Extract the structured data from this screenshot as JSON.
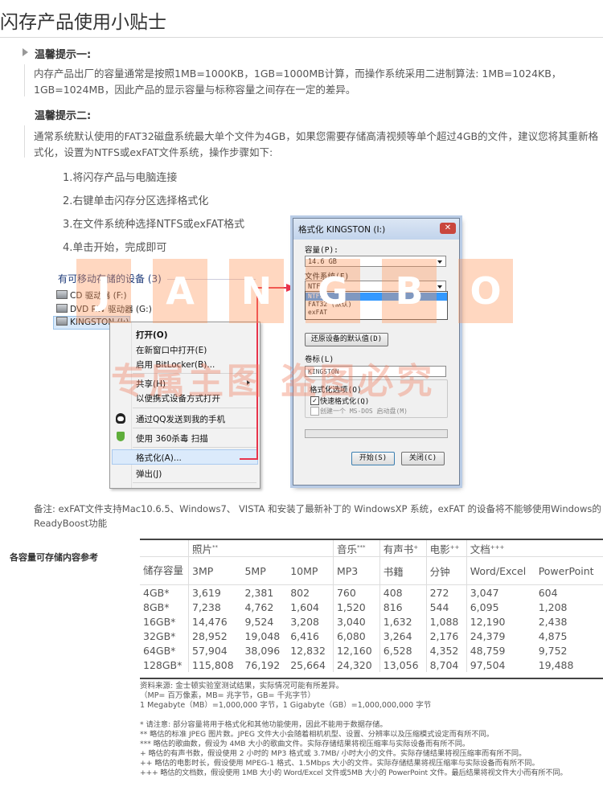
{
  "page": {
    "title": "闪存产品使用小贴士"
  },
  "tip1": {
    "heading": "温馨提示一:",
    "text": "内存产品出厂的容量通常是按照1MB=1000KB，1GB=1000MB计算，而操作系统采用二进制算法: 1MB=1024KB，1GB=1024MB，因此产品的显示容量与标称容量之间存在一定的差异。"
  },
  "tip2": {
    "heading": "温馨提示二:",
    "text": "通常系统默认使用的FAT32磁盘系统最大单个文件为4GB，如果您需要存储高清视频等单个超过4GB的文件，建议您将其重新格式化，设置为NTFS或exFAT文件系统，操作步骤如下:",
    "steps": [
      "1.将闪存产品与电脑连接",
      "2.右键单击闪存分区选择格式化",
      "3.在文件系统种选择NTFS或exFAT格式",
      "4.单击开始，完成即可"
    ]
  },
  "explorer": {
    "group_label": "有可移动存储的设备 (3)",
    "drives": [
      "CD 驱动器 (F:)",
      "DVD RW 驱动器 (G:)",
      "KINGSTON (I:)"
    ]
  },
  "context_menu": {
    "items": [
      "打开(O)",
      "在新窗口中打开(E)",
      "启用 BitLocker(B)...",
      "共享(H)",
      "以便携式设备方式打开",
      "通过QQ发送到我的手机",
      "使用 360杀毒 扫描",
      "格式化(A)...",
      "弹出(J)"
    ]
  },
  "format_dialog": {
    "title": "格式化 KINGSTON (I:)",
    "capacity_label": "容量(P):",
    "capacity_value": "14.6 GB",
    "fs_label": "文件系统(F)",
    "fs_value": "NTFS",
    "fs_options": [
      "NTFS",
      "FAT32 (默认)",
      "exFAT"
    ],
    "restore_button": "还原设备的默认值(D)",
    "volume_label": "卷标(L)",
    "volume_value": "KINGSTON",
    "options_label": "格式化选项(O)",
    "quick_format": "快速格式化(Q)",
    "msdos_disk": "创建一个 MS-DOS 启动盘(M)",
    "start_button": "开始(S)",
    "close_button": "关闭(C)"
  },
  "watermark": {
    "letters": [
      "J",
      "A",
      "N",
      "G",
      "B",
      "O"
    ],
    "text": "专属主图  盗图必究"
  },
  "note": "备注: exFAT文件支持Mac10.6.5、Windows7、 VISTA 和安装了最新补丁的 WindowsXP 系统，exFAT 的设备将不能够使用Windows的ReadyBoost功能",
  "capacity_table": {
    "side_label": "各容量可存储内容参考",
    "groups": [
      {
        "label": "照片",
        "mark": "**"
      },
      {
        "label": "音乐",
        "mark": "***"
      },
      {
        "label": "有声书",
        "mark": "+"
      },
      {
        "label": "电影",
        "mark": "++"
      },
      {
        "label": "文档",
        "mark": "+++"
      }
    ],
    "row_header": "储存容量",
    "subheaders": [
      "3MP",
      "5MP",
      "10MP",
      "MP3",
      "书籍",
      "分钟",
      "Word/Excel",
      "PowerPoint"
    ],
    "rows": [
      [
        "4GB*",
        "3,619",
        "2,381",
        "802",
        "760",
        "408",
        "272",
        "3,047",
        "604"
      ],
      [
        "8GB*",
        "7,238",
        "4,762",
        "1,604",
        "1,520",
        "816",
        "544",
        "6,095",
        "1,208"
      ],
      [
        "16GB*",
        "14,476",
        "9,524",
        "3,208",
        "3,040",
        "1,632",
        "1,088",
        "12,190",
        "2,438"
      ],
      [
        "32GB*",
        "28,952",
        "19,048",
        "6,416",
        "6,080",
        "3,264",
        "2,176",
        "24,379",
        "4,875"
      ],
      [
        "64GB*",
        "57,904",
        "38,096",
        "12,832",
        "12,160",
        "6,528",
        "4,352",
        "48,759",
        "9,752"
      ],
      [
        "128GB*",
        "115,808",
        "76,192",
        "25,664",
        "24,320",
        "13,056",
        "8,704",
        "97,504",
        "19,488"
      ]
    ]
  },
  "source": [
    "资料来源: 金士顿实验室测试结果，实际情况可能有所差异。",
    "（MP= 百万像素，MB= 兆字节，GB= 千兆字节）",
    "1 Megabyte（MB）=1,000,000 字节，1 Gigabyte（GB）=1,000,000,000 字节"
  ],
  "footnotes": [
    "* 请注意: 部分容量将用于格式化和其他功能使用，因此不能用于数据存储。",
    "** 略估的标准 JPEG 图片数。JPEG 文件大小会随着相机机型、设置、分辨率以及压缩模式设定而有所不同。",
    "*** 略估的歌曲数，假设为 4MB 大小的歌曲文件。实际存储结果将视压缩率与实际设备而有所不同。",
    "+ 略估的有声书数，假设使用 2 小时的 MP3 格式或 3.7MB/ 小时大小的文件。实际存储结果将视压缩率而有所不同。",
    "++ 略估的电影时长，假设使用 MPEG-1 格式、1.5Mbps 大小的文件。实际存储结果将视压缩率与实际设备而有所不同。",
    "+++ 略估的文档数，假设使用 1MB 大小的 Word/Excel 文件或5MB 大小的 PowerPoint 文件。最后结果将视文件大小而有所不同。"
  ]
}
